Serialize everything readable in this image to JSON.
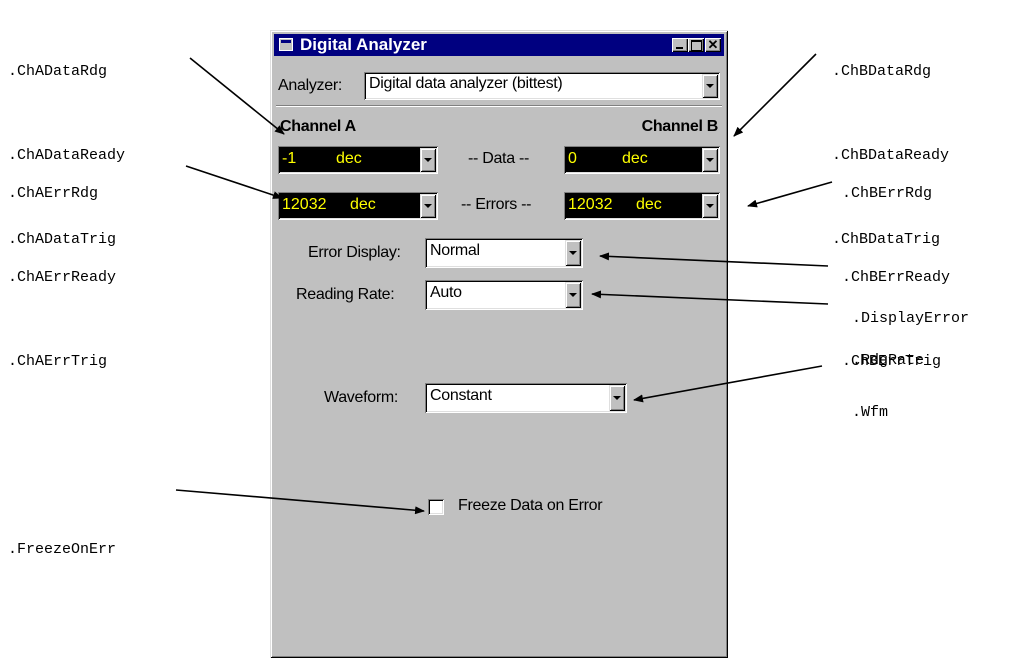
{
  "annotations": {
    "chA_data": [
      ".ChADataRdg",
      ".ChADataReady",
      ".ChADataTrig"
    ],
    "chA_err": [
      ".ChAErrRdg",
      ".ChAErrReady",
      ".ChAErrTrig"
    ],
    "freeze": ".FreezeOnErr",
    "chB_data": [
      ".ChBDataRdg",
      ".ChBDataReady",
      ".ChBDataTrig"
    ],
    "chB_err": [
      ".ChBErrRdg",
      ".ChBErrReady",
      ".ChBErrTrig"
    ],
    "display_error": ".DisplayError",
    "rdg_rate": ".RdgRate",
    "wfm": ".Wfm"
  },
  "window": {
    "title": "Digital Analyzer",
    "analyzer_label": "Analyzer:",
    "analyzer_value": "Digital data analyzer (bittest)",
    "channel_a": "Channel A",
    "channel_b": "Channel B",
    "data_label": "-- Data --",
    "errors_label": "-- Errors --",
    "cha_data": {
      "value": "-1",
      "unit": "dec"
    },
    "chb_data": {
      "value": "0",
      "unit": "dec"
    },
    "cha_err": {
      "value": "12032",
      "unit": "dec"
    },
    "chb_err": {
      "value": "12032",
      "unit": "dec"
    },
    "error_display_label": "Error Display:",
    "error_display_value": "Normal",
    "reading_rate_label": "Reading Rate:",
    "reading_rate_value": "Auto",
    "waveform_label": "Waveform:",
    "waveform_value": "Constant",
    "freeze_label": "Freeze Data on Error",
    "freeze_checked": false
  },
  "colors": {
    "title_bar": "#000080",
    "panel": "#c0c0c0",
    "lcd_background": "#000000",
    "lcd_text": "#ffff00"
  }
}
